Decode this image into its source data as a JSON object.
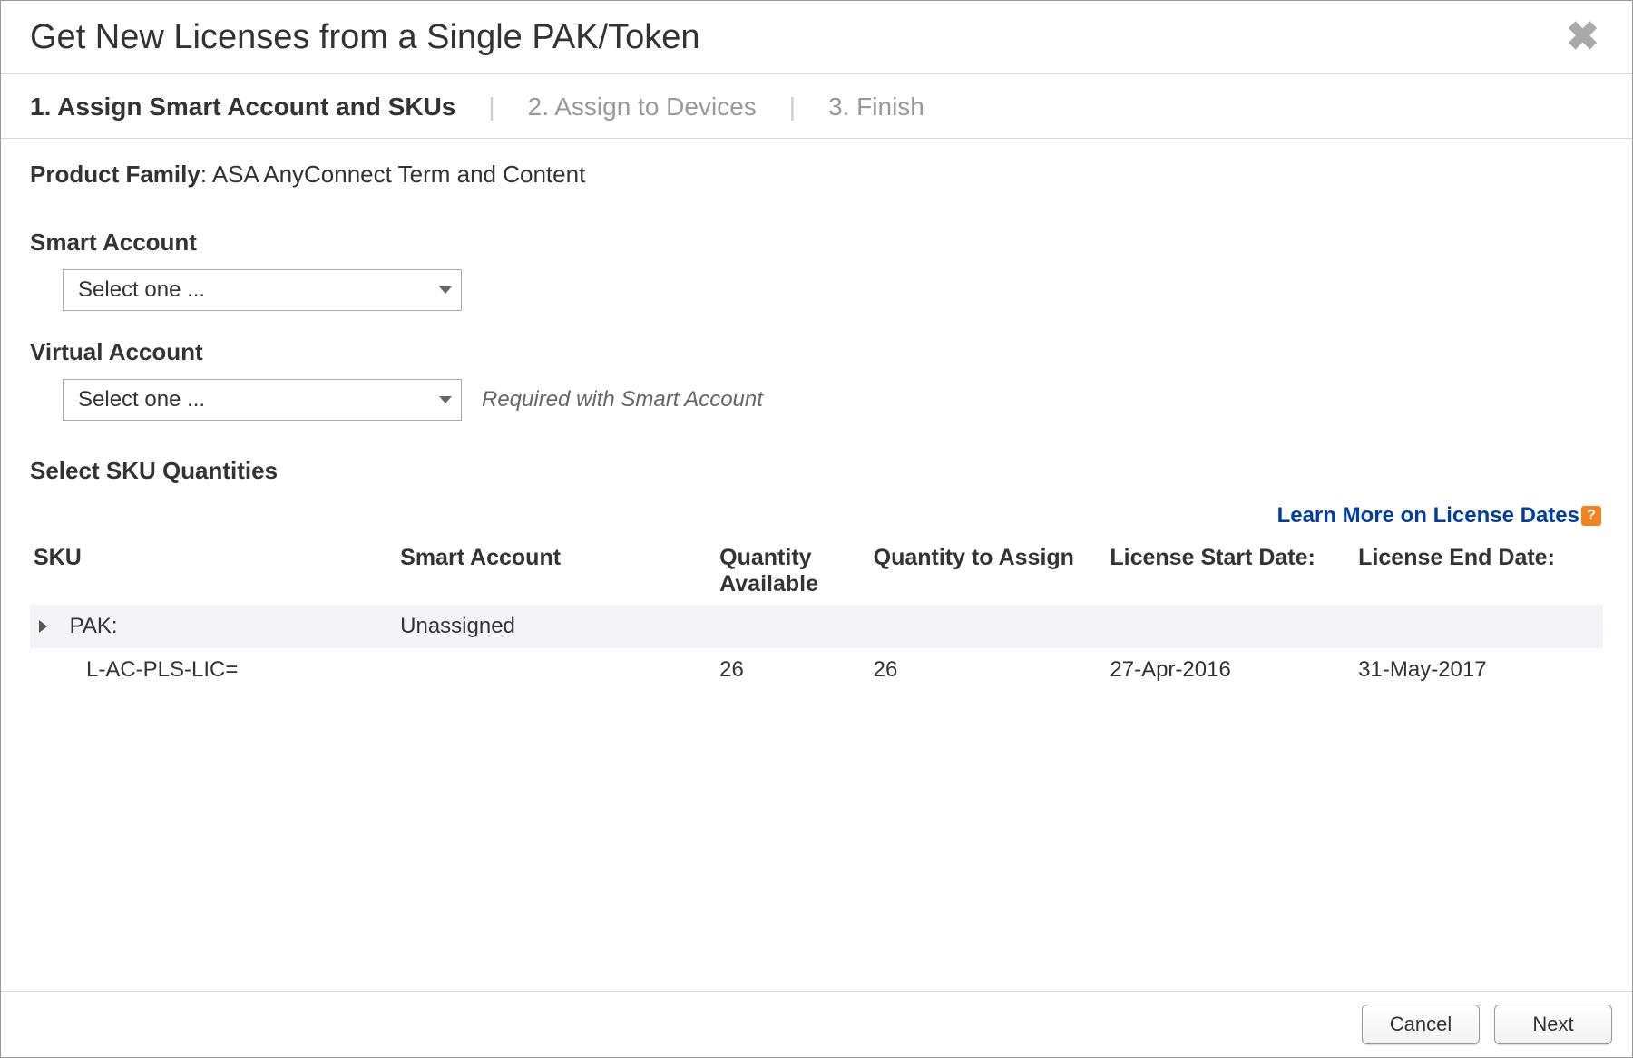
{
  "dialog": {
    "title": "Get New Licenses from a Single PAK/Token"
  },
  "steps": {
    "step1": "1. Assign Smart Account and SKUs",
    "step2": "2. Assign to Devices",
    "step3": "3. Finish"
  },
  "product_family": {
    "label": "Product Family",
    "value": "ASA AnyConnect Term and Content"
  },
  "smart_account": {
    "label": "Smart Account",
    "selected": "Select one ..."
  },
  "virtual_account": {
    "label": "Virtual Account",
    "selected": "Select one ...",
    "hint": "Required with Smart Account"
  },
  "sku_section": {
    "heading": "Select SKU Quantities",
    "learn_more": "Learn More on License Dates",
    "columns": {
      "sku": "SKU",
      "smart_account": "Smart Account",
      "qty_available": "Quantity Available",
      "qty_assign": "Quantity to Assign",
      "start_date": "License Start Date:",
      "end_date": "License End Date:"
    },
    "pak_row": {
      "label": "PAK:",
      "smart_account": "Unassigned"
    },
    "rows": [
      {
        "sku": "L-AC-PLS-LIC=",
        "smart_account": "",
        "qty_available": "26",
        "qty_assign": "26",
        "start_date": "27-Apr-2016",
        "end_date": "31-May-2017"
      }
    ]
  },
  "footer": {
    "cancel": "Cancel",
    "next": "Next"
  }
}
